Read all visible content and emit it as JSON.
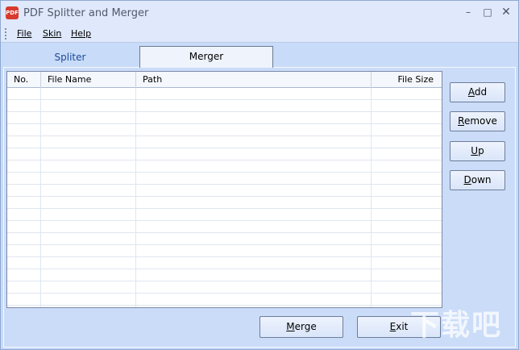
{
  "window": {
    "title": "PDF Splitter and Merger",
    "icon": "pdf-app-icon"
  },
  "window_controls": {
    "minimize": "–",
    "maximize": "□",
    "close": "✕"
  },
  "menu": {
    "file": "File",
    "skin": "Skin",
    "help": "Help"
  },
  "tabs": {
    "spliter": "Spliter",
    "merger": "Merger",
    "active": "Merger"
  },
  "table": {
    "columns": [
      "No.",
      "File Name",
      "Path",
      "File Size"
    ],
    "rows": []
  },
  "buttons": {
    "add_u": "A",
    "add_rest": "dd",
    "remove_u": "R",
    "remove_rest": "emove",
    "up_u": "U",
    "up_rest": "p",
    "down_u": "D",
    "down_rest": "own",
    "merge_u": "M",
    "merge_rest": "erge",
    "exit_u": "E",
    "exit_rest": "xit"
  },
  "watermark": "下载吧"
}
